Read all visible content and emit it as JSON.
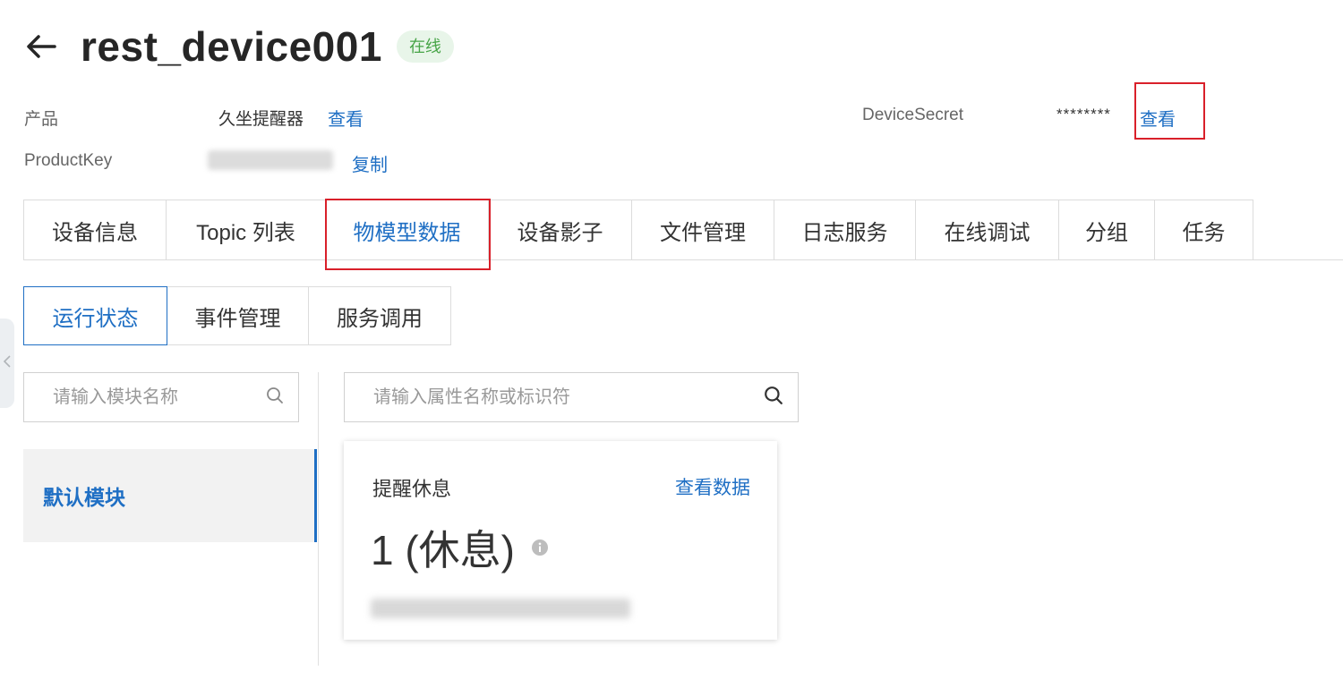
{
  "header": {
    "title": "rest_device001",
    "status": "在线"
  },
  "meta": {
    "product_label": "产品",
    "product_value": "久坐提醒器",
    "product_link": "查看",
    "productkey_label": "ProductKey",
    "productkey_copy": "复制",
    "devicesecret_label": "DeviceSecret",
    "devicesecret_value": "********",
    "devicesecret_link": "查看"
  },
  "tabs": [
    {
      "label": "设备信息"
    },
    {
      "label": "Topic 列表"
    },
    {
      "label": "物模型数据"
    },
    {
      "label": "设备影子"
    },
    {
      "label": "文件管理"
    },
    {
      "label": "日志服务"
    },
    {
      "label": "在线调试"
    },
    {
      "label": "分组"
    },
    {
      "label": "任务"
    }
  ],
  "subtabs": [
    {
      "label": "运行状态"
    },
    {
      "label": "事件管理"
    },
    {
      "label": "服务调用"
    }
  ],
  "module_search": {
    "placeholder": "请输入模块名称"
  },
  "property_search": {
    "placeholder": "请输入属性名称或标识符"
  },
  "modules": [
    {
      "label": "默认模块"
    }
  ],
  "card": {
    "title": "提醒休息",
    "link": "查看数据",
    "value": "1 (休息)"
  },
  "colors": {
    "accent": "#1f6fc4",
    "status_green": "#47a447",
    "highlight_red": "#d9202a"
  }
}
